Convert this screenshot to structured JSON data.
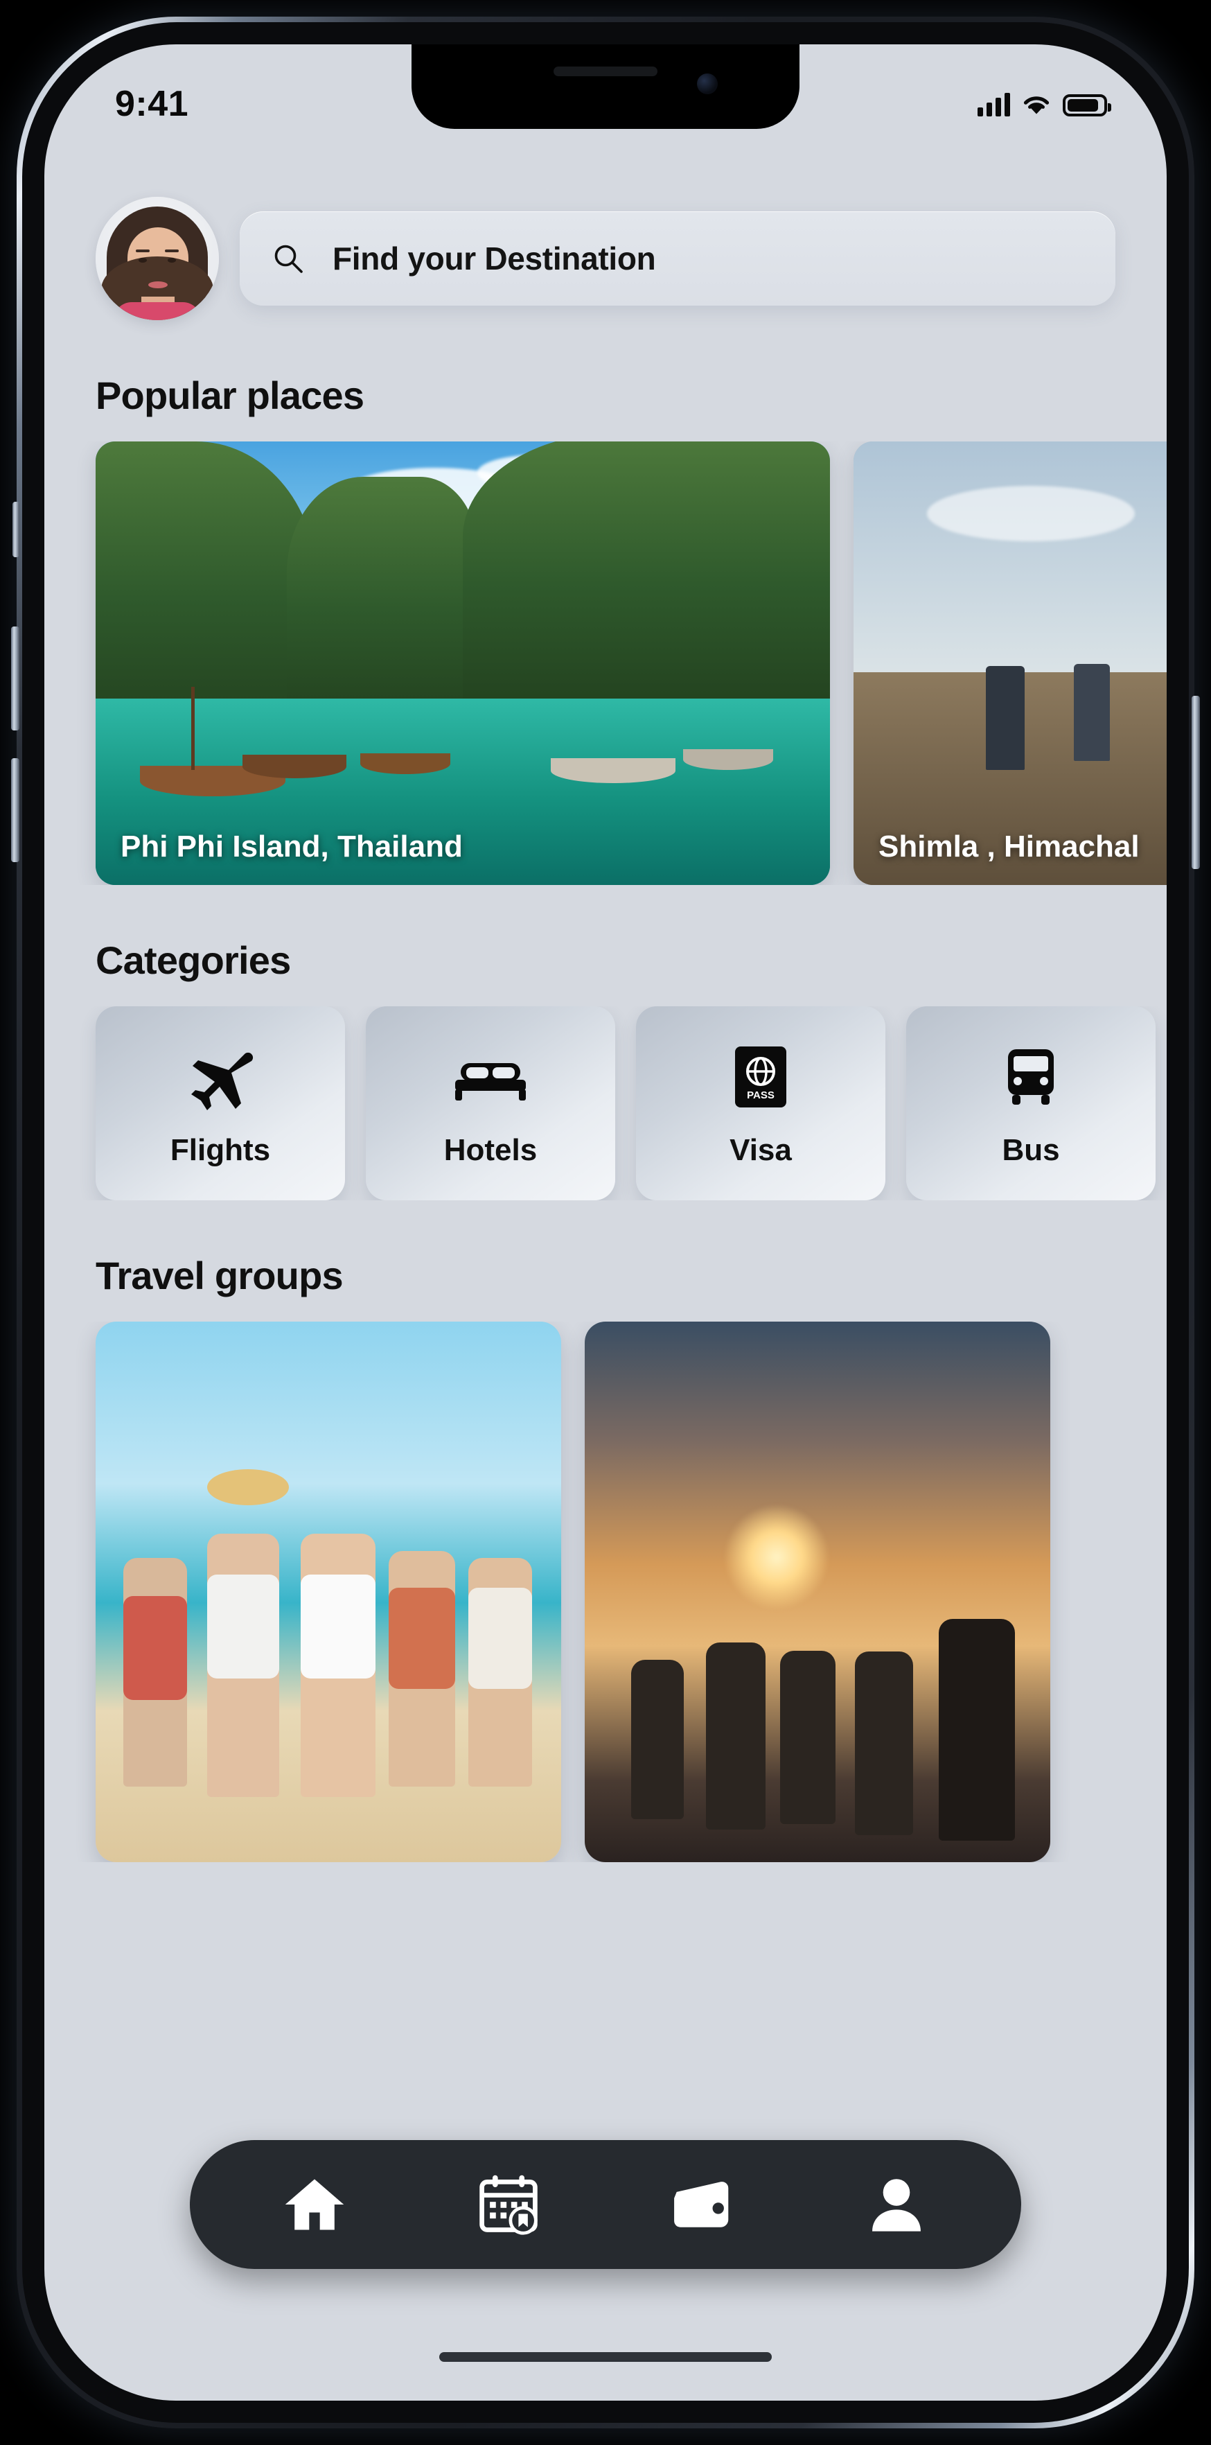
{
  "status_bar": {
    "time": "9:41",
    "signal_icon": "cellular-signal-icon",
    "wifi_icon": "wifi-icon",
    "battery_icon": "battery-icon",
    "battery_level": 85
  },
  "header": {
    "avatar": "user-avatar",
    "search": {
      "icon": "search-icon",
      "placeholder": "Find your Destination",
      "value": ""
    }
  },
  "popular_places": {
    "title": "Popular places",
    "cards": [
      {
        "label": "Phi Phi Island, Thailand",
        "scene": "tropical-island-longtail-boats"
      },
      {
        "label": "Shimla , Himachal",
        "scene": "hikers-mountain-trail"
      }
    ]
  },
  "categories": {
    "title": "Categories",
    "items": [
      {
        "label": "Flights",
        "icon": "airplane-icon"
      },
      {
        "label": "Hotels",
        "icon": "bed-icon"
      },
      {
        "label": "Visa",
        "icon": "passport-icon",
        "badge": "PASS"
      },
      {
        "label": "Bus",
        "icon": "bus-icon"
      }
    ]
  },
  "travel_groups": {
    "title": "Travel groups",
    "cards": [
      {
        "scene": "friends-running-on-beach"
      },
      {
        "scene": "group-watching-mountain-sunrise"
      }
    ]
  },
  "bottom_nav": {
    "items": [
      {
        "name": "home",
        "icon": "home-icon",
        "active": true
      },
      {
        "name": "bookings",
        "icon": "calendar-bookmark-icon",
        "active": false
      },
      {
        "name": "wallet",
        "icon": "wallet-icon",
        "active": false
      },
      {
        "name": "profile",
        "icon": "person-icon",
        "active": false
      }
    ]
  },
  "colors": {
    "screen_bg": "#d5d9e0",
    "nav_bg": "#262a2f",
    "text_primary": "#101010",
    "card_text": "#ffffff"
  }
}
